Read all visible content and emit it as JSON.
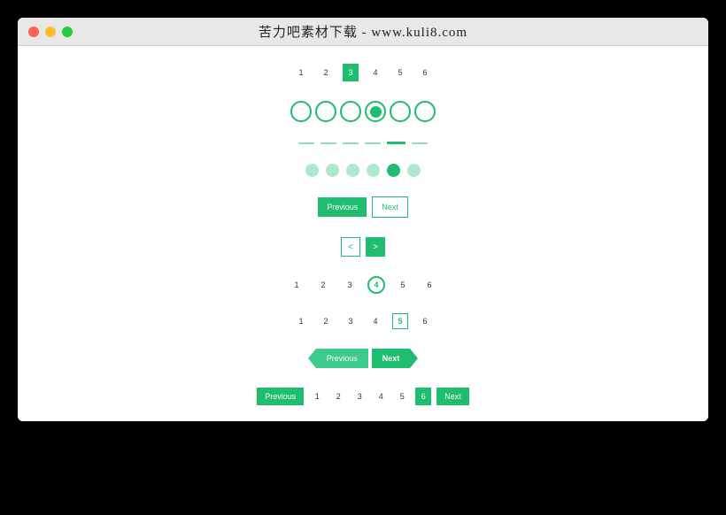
{
  "window": {
    "title": "苦力吧素材下载 - www.kuli8.com"
  },
  "colors": {
    "accent": "#1ebd6f"
  },
  "paginations": {
    "style1": {
      "pages": [
        "1",
        "2",
        "3",
        "4",
        "5",
        "6"
      ],
      "active_index": 2
    },
    "style2": {
      "count": 6,
      "active_index": 3
    },
    "style3": {
      "count": 6,
      "active_index": 4
    },
    "style4": {
      "count": 6,
      "active_index": 4
    },
    "style5": {
      "prev_label": "Previous",
      "next_label": "Next"
    },
    "style6": {
      "prev_label": "<",
      "next_label": ">"
    },
    "style7": {
      "pages": [
        "1",
        "2",
        "3",
        "4",
        "5",
        "6"
      ],
      "active_index": 3
    },
    "style8": {
      "pages": [
        "1",
        "2",
        "3",
        "4",
        "5",
        "6"
      ],
      "active_index": 4
    },
    "style9": {
      "prev_label": "Previous",
      "next_label": "Next"
    },
    "style10": {
      "prev_label": "Previous",
      "next_label": "Next",
      "pages": [
        "1",
        "2",
        "3",
        "4",
        "5",
        "6"
      ],
      "active_index": 5
    }
  }
}
